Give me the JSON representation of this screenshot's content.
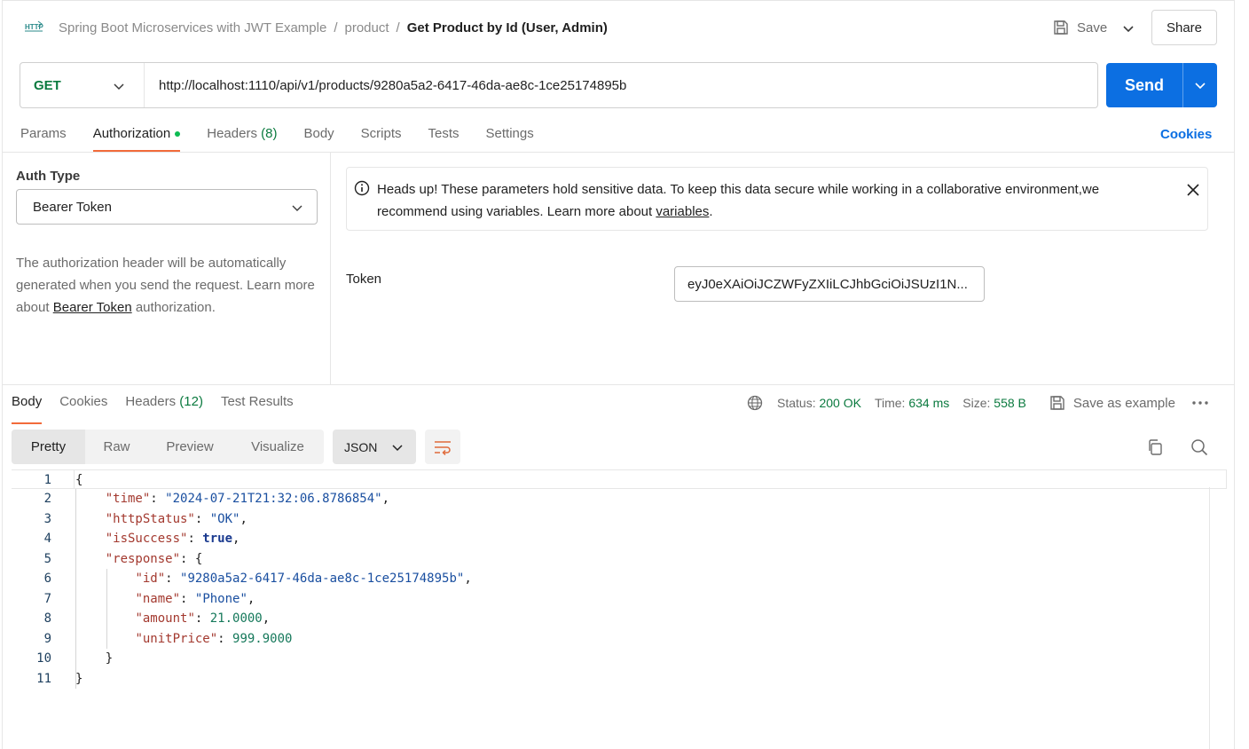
{
  "header": {
    "http_icon_text": "HTTP",
    "breadcrumb": [
      "Spring Boot Microservices with JWT Example",
      "product"
    ],
    "title": "Get Product by Id (User, Admin)",
    "save_label": "Save",
    "share_label": "Share"
  },
  "request": {
    "method": "GET",
    "url": "http://localhost:1110/api/v1/products/9280a5a2-6417-46da-ae8c-1ce25174895b",
    "send_label": "Send",
    "tabs": [
      {
        "label": "Params"
      },
      {
        "label": "Authorization",
        "active": true
      },
      {
        "label": "Headers",
        "count": "(8)"
      },
      {
        "label": "Body"
      },
      {
        "label": "Scripts"
      },
      {
        "label": "Tests"
      },
      {
        "label": "Settings"
      }
    ],
    "cookies_label": "Cookies"
  },
  "auth": {
    "type_label": "Auth Type",
    "type_value": "Bearer Token",
    "desc_before": "The authorization header will be automatically generated when you send the request. Learn more about ",
    "desc_link": "Bearer Token",
    "desc_after": " authorization.",
    "notice_text": "Heads up! These parameters hold sensitive data. To keep this data secure while working in a collaborative environment,we recommend using variables. Learn more about ",
    "notice_link": "variables",
    "notice_end": ".",
    "token_label": "Token",
    "token_value": "eyJ0eXAiOiJCZWFyZXIiLCJhbGciOiJSUzI1N..."
  },
  "response": {
    "tabs": [
      {
        "label": "Body",
        "active": true
      },
      {
        "label": "Cookies"
      },
      {
        "label": "Headers",
        "count": "(12)"
      },
      {
        "label": "Test Results"
      }
    ],
    "status_label": "Status:",
    "status_value": "200 OK",
    "time_label": "Time:",
    "time_value": "634 ms",
    "size_label": "Size:",
    "size_value": "558 B",
    "save_example_label": "Save as example",
    "view_tabs": [
      "Pretty",
      "Raw",
      "Preview",
      "Visualize"
    ],
    "format": "JSON",
    "lines": [
      {
        "n": "1"
      },
      {
        "n": "2"
      },
      {
        "n": "3"
      },
      {
        "n": "4"
      },
      {
        "n": "5"
      },
      {
        "n": "6"
      },
      {
        "n": "7"
      },
      {
        "n": "8"
      },
      {
        "n": "9"
      },
      {
        "n": "10"
      },
      {
        "n": "11"
      }
    ],
    "body": {
      "time": "2024-07-21T21:32:06.8786854",
      "httpStatus": "OK",
      "isSuccess": "true",
      "id": "9280a5a2-6417-46da-ae8c-1ce25174895b",
      "name": "Phone",
      "amount": "21.0000",
      "unitPrice": "999.9000"
    }
  },
  "colors": {
    "accent": "#0c6fe2",
    "tab_indicator": "#f26b3a",
    "success": "#0b7a3f"
  }
}
